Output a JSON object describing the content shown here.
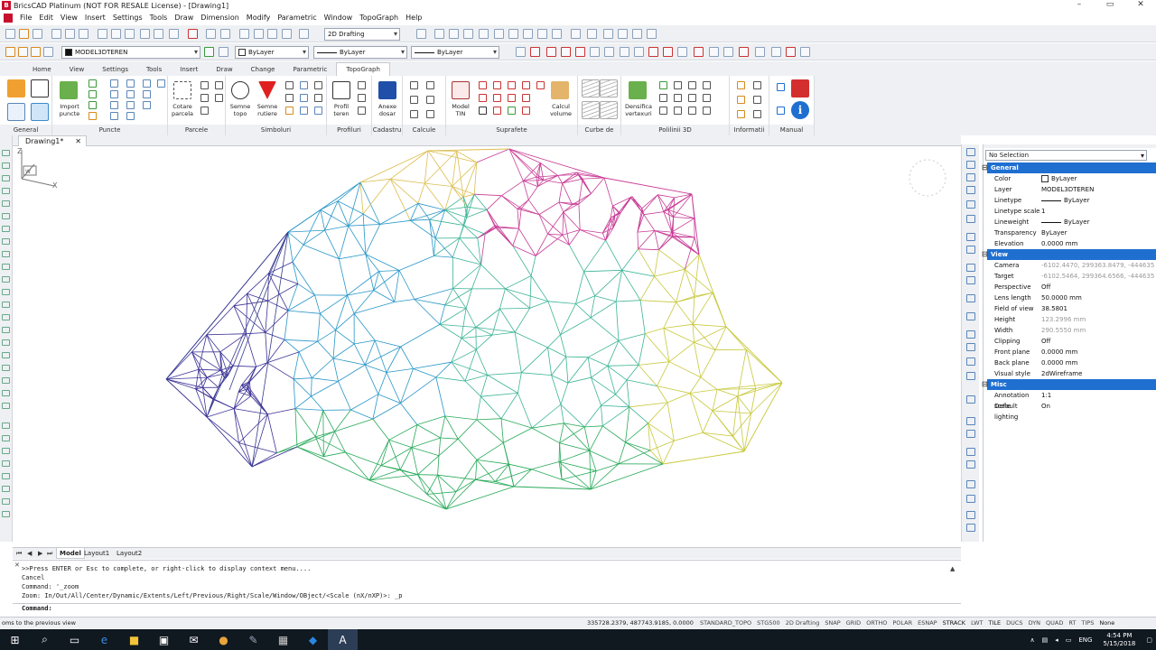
{
  "window": {
    "title": "BricsCAD Platinum (NOT FOR RESALE License) - [Drawing1]",
    "controls": [
      "–",
      "▭",
      "✕"
    ]
  },
  "menu": [
    "File",
    "Edit",
    "View",
    "Insert",
    "Settings",
    "Tools",
    "Draw",
    "Dimension",
    "Modify",
    "Parametric",
    "Window",
    "TopoGraph",
    "Help"
  ],
  "toolbar": {
    "workspace": "2D Drafting",
    "layer": "MODEL3DTEREN",
    "color": "ByLayer",
    "linetype": "ByLayer",
    "lineweight": "ByLayer"
  },
  "ribbon_tabs": {
    "items": [
      "Home",
      "View",
      "Settings",
      "Tools",
      "Insert",
      "Draw",
      "Change",
      "Parametric",
      "TopoGraph"
    ],
    "active": "TopoGraph"
  },
  "ribbon_panels": {
    "general": "General",
    "puncte": "Puncte",
    "import_puncte": "Import puncte",
    "parcele": "Parcele",
    "cotare_parcela": "Cotare parcela",
    "simboluri": "Simboluri",
    "semne_topo": "Semne topo",
    "semne_rutiere": "Semne rutiere",
    "profiluri": "Profiluri",
    "profil_teren": "Profil teren",
    "cadastru": "Cadastru",
    "anexe_dosar": "Anexe dosar",
    "calcule": "Calcule",
    "suprafete": "Suprafete",
    "model_tin": "Model TIN",
    "calcul_volume": "Calcul volume",
    "curbe_de_nivel": "Curbe de nivel",
    "polilinii_3d": "Polilinii 3D",
    "densifica_vertexuri": "Densifica vertexuri",
    "informatii": "Informatii",
    "manual": "Manual"
  },
  "document_tab": {
    "name": "Drawing1*",
    "close": "✕"
  },
  "layout_tabs": {
    "items": [
      "Model",
      "Layout1",
      "Layout2"
    ],
    "active": "Model"
  },
  "command_history": [
    ">>Press ENTER or Esc to complete, or right-click to display context menu....",
    "Cancel",
    "Command: '_zoom",
    "Zoom:  In/Out/All/Center/Dynamic/Extents/Left/Previous/Right/Scale/Window/OBject/<Scale (nX/nXP)>: _p"
  ],
  "command_prompt": "Command:",
  "status_bar": {
    "hint": "oms to the previous view",
    "coordinates": "335728.2379, 487743.9185, 0.0000",
    "items": [
      "STANDARD_TOPO",
      "STG500",
      "2D Drafting",
      "SNAP",
      "GRID",
      "ORTHO",
      "POLAR",
      "ESNAP",
      "STRACK",
      "LWT",
      "TILE",
      "DUCS",
      "DYN",
      "QUAD",
      "RT",
      "TIPS",
      "None"
    ]
  },
  "properties": {
    "selection": "No Selection",
    "sections": [
      {
        "title": "General",
        "rows": [
          {
            "k": "Color",
            "v": "ByLayer",
            "swatch": true
          },
          {
            "k": "Layer",
            "v": "MODEL3DTEREN"
          },
          {
            "k": "Linetype",
            "v": "ByLayer",
            "line": true
          },
          {
            "k": "Linetype scale",
            "v": "1"
          },
          {
            "k": "Lineweight",
            "v": "ByLayer",
            "line": true
          },
          {
            "k": "Transparency",
            "v": "ByLayer"
          },
          {
            "k": "Elevation",
            "v": "0.0000 mm"
          }
        ]
      },
      {
        "title": "View",
        "rows": [
          {
            "k": "Camera",
            "v": "-6102.4470, 299363.8479, -444635",
            "gray": true
          },
          {
            "k": "Target",
            "v": "-6102.5464, 299364.6566, -444635",
            "gray": true
          },
          {
            "k": "Perspective",
            "v": "Off"
          },
          {
            "k": "Lens length",
            "v": "50.0000 mm"
          },
          {
            "k": "Field of view",
            "v": "38.5801"
          },
          {
            "k": "Height",
            "v": "123.2996 mm",
            "gray": true
          },
          {
            "k": "Width",
            "v": "290.5550 mm",
            "gray": true
          },
          {
            "k": "Clipping",
            "v": "Off"
          },
          {
            "k": "Front plane",
            "v": "0.0000 mm"
          },
          {
            "k": "Back plane",
            "v": "0.0000 mm"
          },
          {
            "k": "Visual style",
            "v": "2dWireframe"
          }
        ]
      },
      {
        "title": "Misc",
        "rows": [
          {
            "k": "Annotation scale",
            "v": "1:1"
          },
          {
            "k": "Default lighting",
            "v": "On"
          }
        ]
      }
    ]
  },
  "taskbar": {
    "tray": [
      "∧",
      "ENG"
    ],
    "time": "4:54 PM",
    "date": "5/15/2018"
  },
  "colors": {
    "accent": "#1f6fd1",
    "brand": "#c8102e",
    "taskbar": "#101820"
  }
}
